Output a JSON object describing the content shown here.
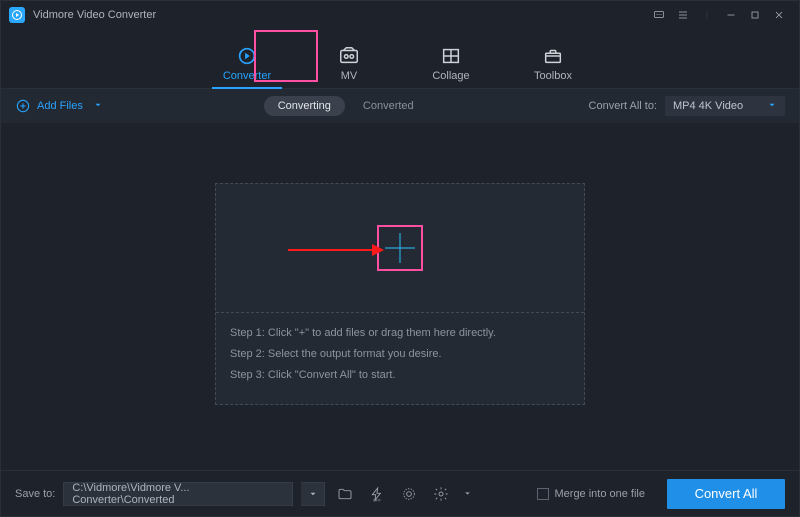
{
  "titlebar": {
    "title": "Vidmore Video Converter"
  },
  "tabs": {
    "converter": "Converter",
    "mv": "MV",
    "collage": "Collage",
    "toolbox": "Toolbox"
  },
  "subbar": {
    "add_files": "Add Files",
    "converting": "Converting",
    "converted": "Converted",
    "convert_all_to": "Convert All to:",
    "format_selected": "MP4 4K Video"
  },
  "droparea": {
    "step1": "Step 1: Click \"+\" to add files or drag them here directly.",
    "step2": "Step 2: Select the output format you desire.",
    "step3": "Step 3: Click \"Convert All\" to start."
  },
  "footer": {
    "save_to": "Save to:",
    "path": "C:\\Vidmore\\Vidmore V... Converter\\Converted",
    "merge": "Merge into one file",
    "convert_all": "Convert All"
  }
}
